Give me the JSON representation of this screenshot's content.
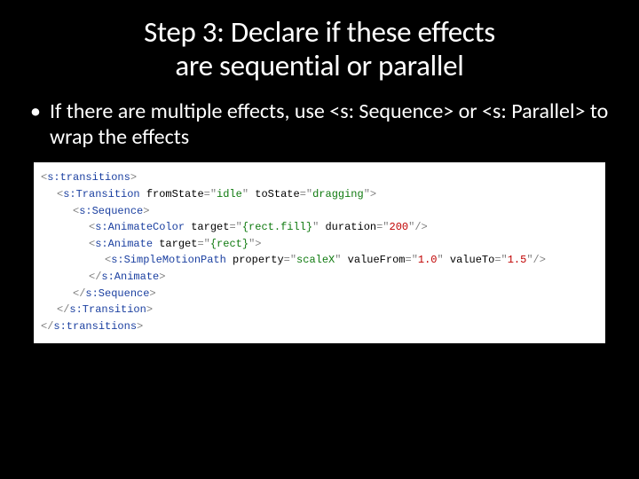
{
  "title_line1": "Step 3: Declare if these effects",
  "title_line2": "are sequential or parallel",
  "bullet_text": "If there are multiple effects, use  <s: Sequence> or <s: Parallel> to wrap the effects",
  "code": {
    "tags": {
      "transitions_open": "s:transitions",
      "transition_open": "s:Transition",
      "sequence_open": "s:Sequence",
      "animate_color": "s:AnimateColor",
      "animate": "s:Animate",
      "simple_motion_path": "s:SimpleMotionPath",
      "animate_close": "s:Animate",
      "sequence_close": "s:Sequence",
      "transition_close": "s:Transition",
      "transitions_close": "s:transitions"
    },
    "attrs": {
      "fromState": "fromState",
      "toState": "toState",
      "target": "target",
      "duration": "duration",
      "property": "property",
      "valueFrom": "valueFrom",
      "valueTo": "valueTo"
    },
    "values": {
      "idle": "idle",
      "dragging": "dragging",
      "rect_fill": "{rect.fill}",
      "duration_200": "200",
      "rect": "{rect}",
      "scaleX": "scaleX",
      "one": "1.0",
      "one_five": "1.5"
    }
  }
}
